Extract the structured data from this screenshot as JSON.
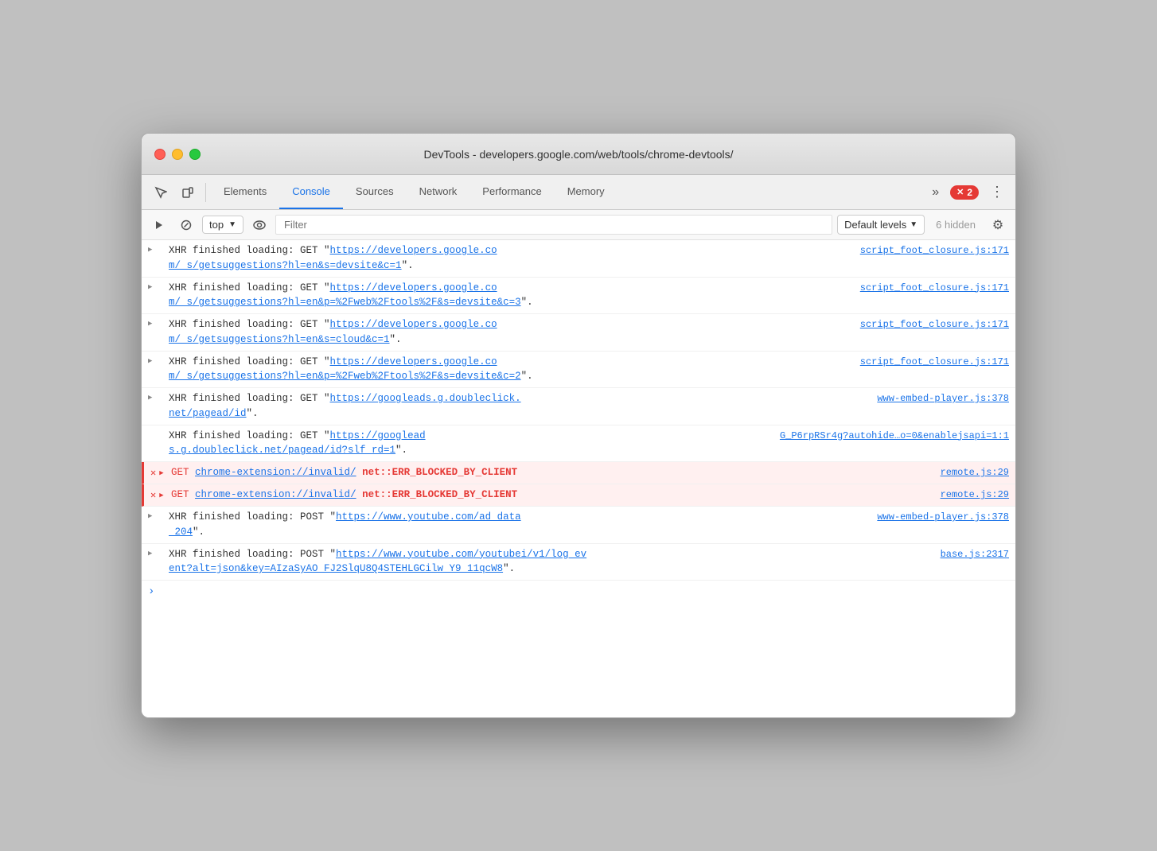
{
  "window": {
    "title": "DevTools - developers.google.com/web/tools/chrome-devtools/"
  },
  "toolbar": {
    "tabs": [
      {
        "id": "elements",
        "label": "Elements",
        "active": false
      },
      {
        "id": "console",
        "label": "Console",
        "active": true
      },
      {
        "id": "sources",
        "label": "Sources",
        "active": false
      },
      {
        "id": "network",
        "label": "Network",
        "active": false
      },
      {
        "id": "performance",
        "label": "Performance",
        "active": false
      },
      {
        "id": "memory",
        "label": "Memory",
        "active": false
      }
    ],
    "error_count": "2",
    "more_label": "»"
  },
  "console_toolbar": {
    "context": "top",
    "filter_placeholder": "Filter",
    "levels_label": "Default levels",
    "hidden_label": "6 hidden"
  },
  "log_entries": [
    {
      "id": 1,
      "type": "info",
      "has_triangle": true,
      "text": "XHR finished loading: GET \"https://developers.google.co",
      "text2": "m/_s/getsuggestions?hl=en&s=devsite&c=1\".",
      "source": "script_foot_closure.js:171"
    },
    {
      "id": 2,
      "type": "info",
      "has_triangle": true,
      "text": "XHR finished loading: GET \"https://developers.google.co",
      "text2": "m/_s/getsuggestions?hl=en&p=%2Fweb%2Ftools%2F&s=devsite&c=3\".",
      "source": "script_foot_closure.js:171"
    },
    {
      "id": 3,
      "type": "info",
      "has_triangle": true,
      "text": "XHR finished loading: GET \"https://developers.google.co",
      "text2": "m/_s/getsuggestions?hl=en&s=cloud&c=1\".",
      "source": "script_foot_closure.js:171"
    },
    {
      "id": 4,
      "type": "info",
      "has_triangle": true,
      "text": "XHR finished loading: GET \"https://developers.google.co",
      "text2": "m/_s/getsuggestions?hl=en&p=%2Fweb%2Ftools%2F&s=devsite&c=2\".",
      "source": "script_foot_closure.js:171"
    },
    {
      "id": 5,
      "type": "info",
      "has_triangle": true,
      "text": "XHR finished loading: GET \"https://googleads.g.doubleclick.",
      "text2": "net/pagead/id\".",
      "source": "www-embed-player.js:378"
    },
    {
      "id": 6,
      "type": "info",
      "has_triangle": false,
      "text": "XHR finished loading: GET \"https://googlead",
      "text2": "s.g.doubleclick.net/pagead/id?slf_rd=1\".",
      "source": "G_P6rpRSr4g?autohide…o=0&enablejsapi=1:1"
    },
    {
      "id": 7,
      "type": "error",
      "has_triangle": true,
      "text_get": "GET",
      "text_url": "chrome-extension://invalid/",
      "text_err": " net::ERR_BLOCKED_BY_CLIENT",
      "source": "remote.js:29"
    },
    {
      "id": 8,
      "type": "error",
      "has_triangle": true,
      "text_get": "GET",
      "text_url": "chrome-extension://invalid/",
      "text_err": " net::ERR_BLOCKED_BY_CLIENT",
      "source": "remote.js:29"
    },
    {
      "id": 9,
      "type": "info",
      "has_triangle": true,
      "text": "XHR finished loading: POST \"https://www.youtube.com/ad_data",
      "text2": "_204\".",
      "source": "www-embed-player.js:378"
    },
    {
      "id": 10,
      "type": "info",
      "has_triangle": true,
      "text": "XHR finished loading: POST \"https://www.youtube.com/youtubei/v1/log_ev",
      "text2": "ent?alt=json&key=AIzaSyAO_FJ2SlqU8Q4STEHLGCilw_Y9_11qcW8\".",
      "source": "base.js:2317"
    }
  ]
}
